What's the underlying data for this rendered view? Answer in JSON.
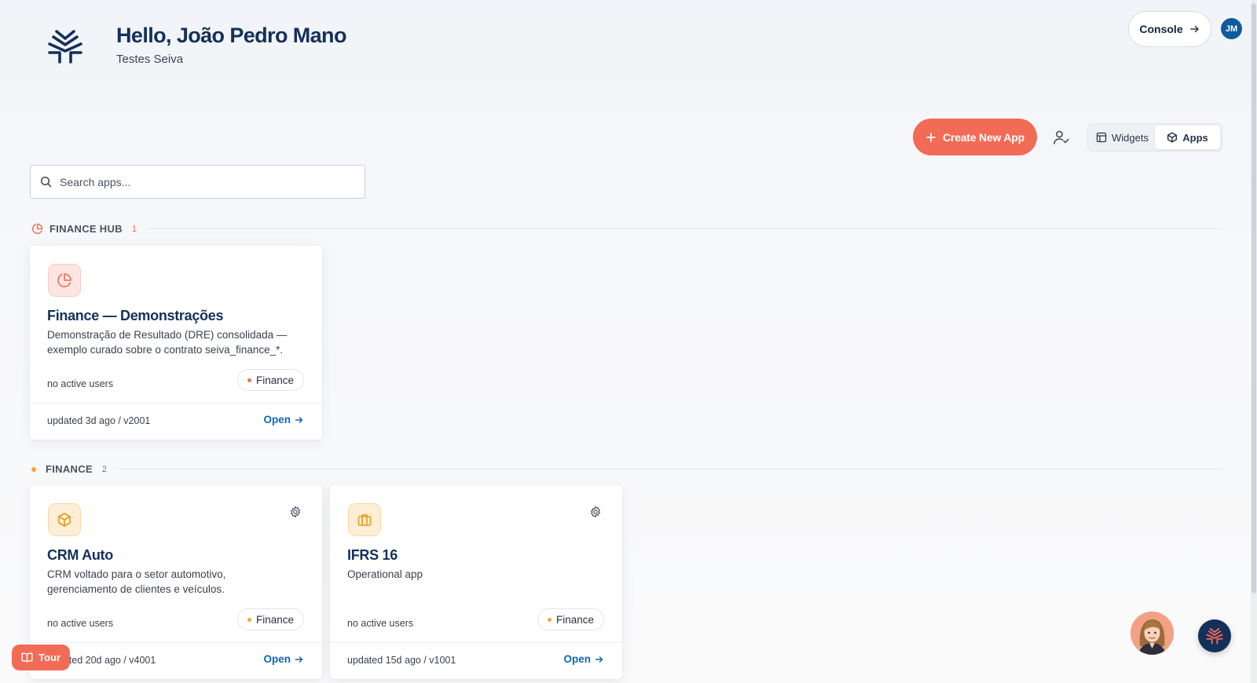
{
  "header": {
    "greeting": "Hello, João Pedro Mano",
    "workspace": "Testes Seiva",
    "console_label": "Console",
    "user_initials": "JM"
  },
  "toolbar": {
    "create_label": "Create New App",
    "view_toggle": [
      {
        "label": "Widgets",
        "icon": "layout-icon",
        "active": false
      },
      {
        "label": "Apps",
        "icon": "box-icon",
        "active": true
      }
    ]
  },
  "search": {
    "placeholder": "Search apps..."
  },
  "colors": {
    "accent": "#f26b57",
    "brand": "#14305a",
    "link": "#1267b3",
    "amber": "#f0a830"
  },
  "sections": [
    {
      "title": "FINANCE HUB",
      "count": "1",
      "cards": [
        {
          "name": "Finance — Demonstrações",
          "description": "Demonstração de Resultado (DRE) consolidada — exemplo curado sobre o contrato seiva_finance_*.",
          "users": "no active users",
          "tag": "Finance",
          "updated": "updated 3d ago / v2001",
          "open_label": "Open",
          "icon": "pie-chart-icon"
        }
      ]
    },
    {
      "title": "FINANCE",
      "count": "2",
      "cards": [
        {
          "name": "CRM Auto",
          "description": "CRM voltado para o setor automotivo, gerenciamento de clientes e veículos.",
          "users": "no active users",
          "tag": "Finance",
          "updated": "updated 20d ago / v4001",
          "open_label": "Open",
          "icon": "box-icon"
        },
        {
          "name": "IFRS 16",
          "description": "Operational app",
          "users": "no active users",
          "tag": "Finance",
          "updated": "updated 15d ago / v1001",
          "open_label": "Open",
          "icon": "briefcase-icon"
        }
      ]
    }
  ],
  "tour": {
    "label": "Tour"
  }
}
